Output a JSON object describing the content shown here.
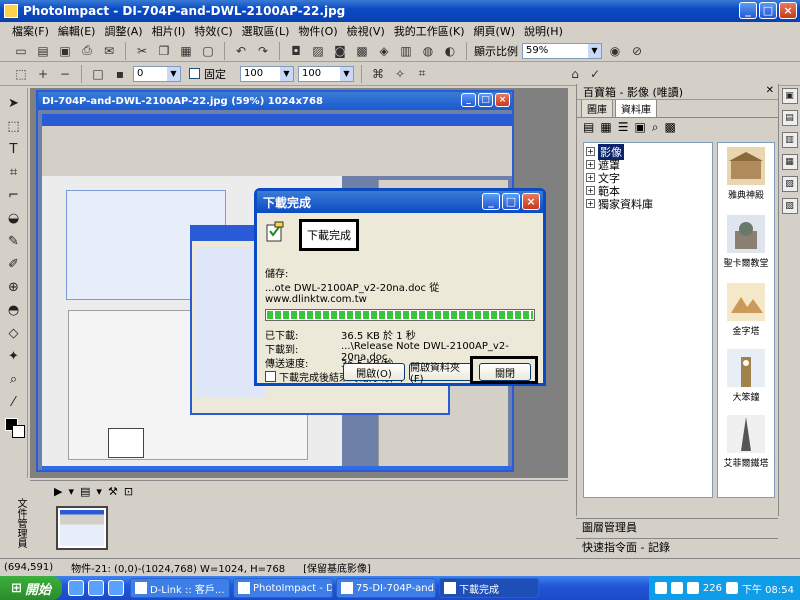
{
  "app": {
    "title": "PhotoImpact - DI-704P-and-DWL-2100AP-22.jpg"
  },
  "menu": [
    "檔案(F)",
    "編輯(E)",
    "調整(A)",
    "相片(I)",
    "特效(C)",
    "選取區(L)",
    "物件(O)",
    "檢視(V)",
    "我的工作區(K)",
    "網頁(W)",
    "說明(H)"
  ],
  "toolbar1": {
    "zoom_label": "顯示比例",
    "zoom_value": "59%"
  },
  "toolbar2": {
    "value1": "0",
    "fixed_label": "固定",
    "width": "100",
    "height": "100"
  },
  "document": {
    "title": "DI-704P-and-DWL-2100AP-22.jpg (59%) 1024x768"
  },
  "dialog": {
    "title": "下載完成",
    "heading": "下載完成",
    "save_label": "儲存:",
    "save_value": "...ote DWL-2100AP_v2-20na.doc 從 www.dlinktw.com.tw",
    "downloaded_label": "已下載:",
    "downloaded_value": "36.5 KB 於 1 秒",
    "downloadto_label": "下載到:",
    "downloadto_value": "...\\Release Note DWL-2100AP_v2-20na.doc",
    "speed_label": "傳送速度:",
    "speed_value": "36.5 KB/秒",
    "checkbox_label": "下載完成後結束對話方塊(C)",
    "btn_open": "開啟(O)",
    "btn_open_folder": "開啟資料夾(F)",
    "btn_close": "關閉",
    "progress": 1.0
  },
  "rightpanel": {
    "title": "百寶箱 - 影像 (唯讀)",
    "tabs": [
      "圖庫",
      "資料庫"
    ],
    "tree": [
      "影像",
      "遮罩",
      "文字",
      "範本",
      "獨家資料庫"
    ],
    "gallery": [
      "雅典神殿",
      "聖卡爾教堂",
      "金字塔",
      "大笨鐘",
      "艾菲爾鐵塔"
    ],
    "layer_manager": "圖層管理員",
    "quick_command": "快速指令面 - 記錄"
  },
  "bottompanel": {
    "vertical_label": "文件管理員"
  },
  "status": {
    "coords": "(694,591)",
    "object": "物件-21: (0,0)-(1024,768) W=1024, H=768",
    "hint": "[保留基底影像]"
  },
  "taskbar": {
    "start": "開始",
    "tasks": [
      "D-Link :: 客戶...",
      "PhotoImpact - D...",
      "75-DI-704P-and...",
      "下載完成"
    ],
    "clock": "下午 08:54",
    "tray_num": "226"
  }
}
